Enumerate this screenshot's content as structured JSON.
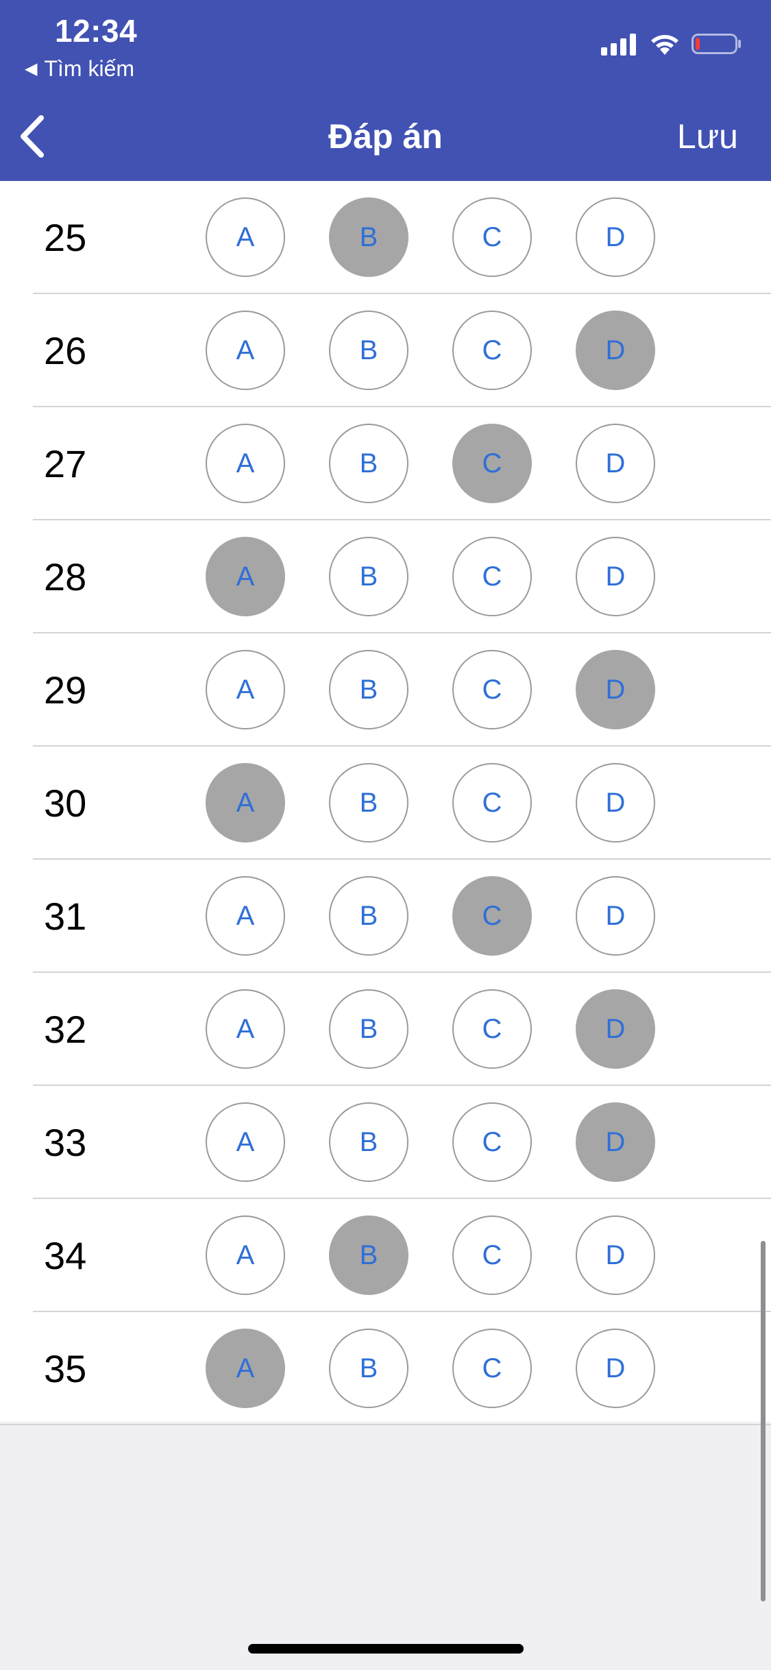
{
  "status_bar": {
    "time": "12:34",
    "back_app": "Tìm kiếm",
    "battery_level": 0.1
  },
  "nav": {
    "title": "Đáp án",
    "save": "Lưu"
  },
  "choices": [
    "A",
    "B",
    "C",
    "D"
  ],
  "questions": [
    {
      "num": "25",
      "selected": "B"
    },
    {
      "num": "26",
      "selected": "D"
    },
    {
      "num": "27",
      "selected": "C"
    },
    {
      "num": "28",
      "selected": "A"
    },
    {
      "num": "29",
      "selected": "D"
    },
    {
      "num": "30",
      "selected": "A"
    },
    {
      "num": "31",
      "selected": "C"
    },
    {
      "num": "32",
      "selected": "D"
    },
    {
      "num": "33",
      "selected": "D"
    },
    {
      "num": "34",
      "selected": "B"
    },
    {
      "num": "35",
      "selected": "A"
    }
  ],
  "colors": {
    "nav_background": "#4152b3",
    "choice_text": "#2f6fd8",
    "selected_fill": "#a6a6a6"
  }
}
